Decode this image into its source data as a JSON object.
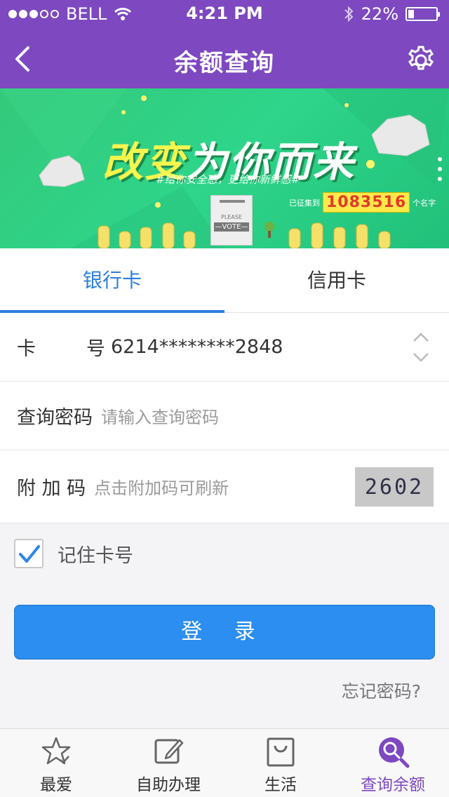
{
  "status_bar": {
    "carrier": "BELL",
    "time": "4:21 PM",
    "battery": "22%",
    "battery_level": 0.22
  },
  "navbar": {
    "title": "余额查询",
    "back_icon": "chevron-left-icon",
    "settings_icon": "gear-icon"
  },
  "banner": {
    "headline_part1": "改变",
    "headline_part2": "为你而来",
    "subtitle": "#给你安全感，更给你新鲜感#",
    "counter_prefix": "已征集到",
    "counter_value": "1083516",
    "counter_suffix": "个名字",
    "vote_please": "PLEASE",
    "vote_label": "—VOTE—"
  },
  "tabs": [
    {
      "label": "银行卡",
      "active": true
    },
    {
      "label": "信用卡",
      "active": false
    }
  ],
  "form": {
    "card_label_1": "卡",
    "card_label_2": "号",
    "card_number": "6214********2848",
    "password_label": "查询密码",
    "password_placeholder": "请输入查询密码",
    "captcha_label": "附 加 码",
    "captcha_placeholder": "点击附加码可刷新",
    "captcha_value": "2602",
    "remember_label": "记住卡号",
    "remember_checked": true,
    "login_label": "登 录",
    "forgot_label": "忘记密码?"
  },
  "tabbar": [
    {
      "label": "最爱",
      "icon": "star-icon",
      "active": false
    },
    {
      "label": "自助办理",
      "icon": "edit-icon",
      "active": false
    },
    {
      "label": "生活",
      "icon": "shopping-bag-icon",
      "active": false
    },
    {
      "label": "查询余额",
      "icon": "search-icon",
      "active": true
    }
  ],
  "colors": {
    "brand_purple": "#7d48c0",
    "accent_blue": "#2a7fde",
    "button_blue": "#2b8ef0",
    "banner_green": "#2ed58a"
  }
}
